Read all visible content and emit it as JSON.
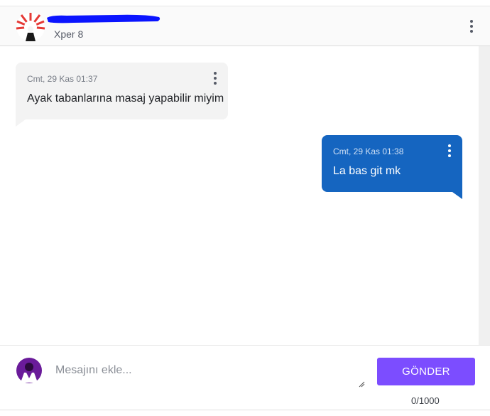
{
  "header": {
    "contact_name": "",
    "contact_subtitle": "Xper 8",
    "redaction_color": "#0a14ff"
  },
  "messages": [
    {
      "direction": "incoming",
      "time": "Cmt, 29 Kas 01:37",
      "text": "Ayak tabanlarına masaj yapabilir miyim",
      "menu_icon": "more-vertical-icon"
    },
    {
      "direction": "outgoing",
      "time": "Cmt, 29 Kas 01:38",
      "text": "La bas git mk",
      "menu_icon": "more-vertical-icon"
    }
  ],
  "composer": {
    "placeholder": "Mesajını ekle...",
    "value": "",
    "send_label": "GÖNDER",
    "char_count": "0/1000"
  },
  "colors": {
    "outgoing_bubble": "#1565c0",
    "incoming_bubble": "#f3f3f3",
    "send_button": "#7c4dff"
  }
}
